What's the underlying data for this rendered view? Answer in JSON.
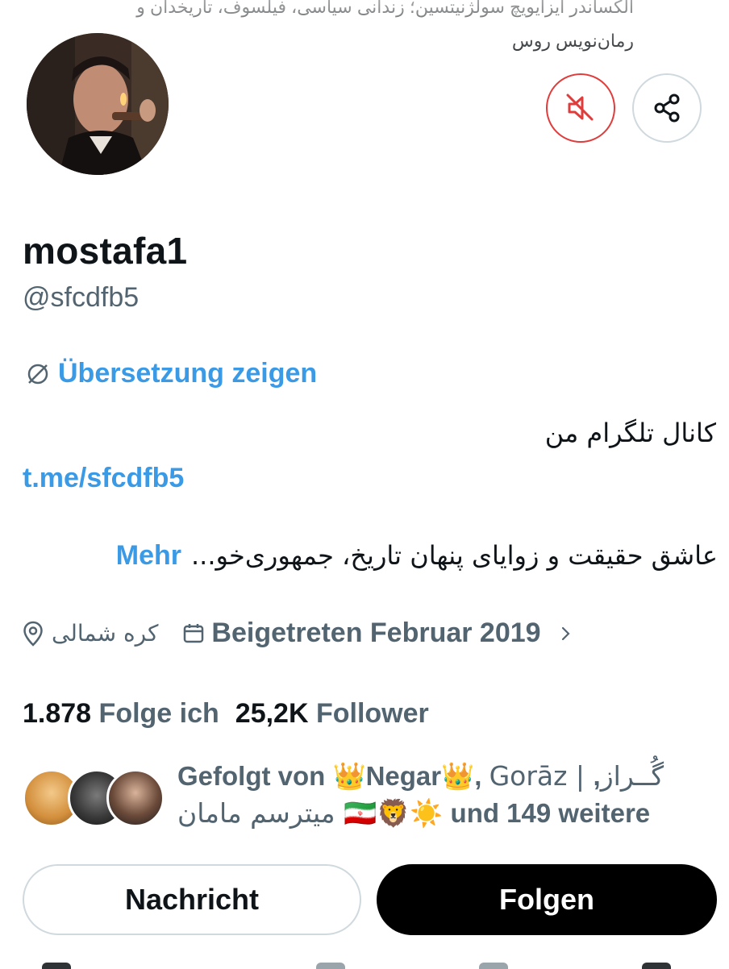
{
  "header_text": "الکساندر ایزایویچ سولژنیتسین؛ زندانی سیاسی، فیلسوف، تاریخدان و رمان‌نویس روس",
  "profile": {
    "display_name": "mostafa1",
    "handle": "@sfcdfb5",
    "translate_label": "Übersetzung zeigen",
    "bio_line1": "کانال تلگرام من",
    "link": "t.me/sfcdfb5",
    "bio_line2": "عاشق حقیقت و زوایای پنهان تاریخ، جمهوری‌خو...",
    "more_label": "Mehr",
    "location": "کره شمالی",
    "joined": "Beigetreten Februar 2019"
  },
  "stats": {
    "following_count": "1.878",
    "following_label": "Folge ich",
    "followers_count": "25,2K",
    "followers_label": "Follower"
  },
  "followed_by": {
    "prefix": "Gefolgt von ",
    "name1": "👑Negar👑",
    "sep1": ", ",
    "name2": "Gorāz | گُــراز",
    "sep2": ", ",
    "name3": "میترسم مامان 🇮🇷🦁☀️",
    "suffix": " und 149 weitere"
  },
  "buttons": {
    "message": "Nachricht",
    "follow": "Folgen"
  },
  "icons": {
    "mute": "speaker-muted-icon",
    "share": "share-icon",
    "translate": "translate-icon",
    "location": "location-pin-icon",
    "calendar": "calendar-icon",
    "chevron": "chevron-right-icon"
  },
  "colors": {
    "link": "#3a9ae6",
    "mute_red": "#e03c3c",
    "follow_bg": "#000000"
  }
}
